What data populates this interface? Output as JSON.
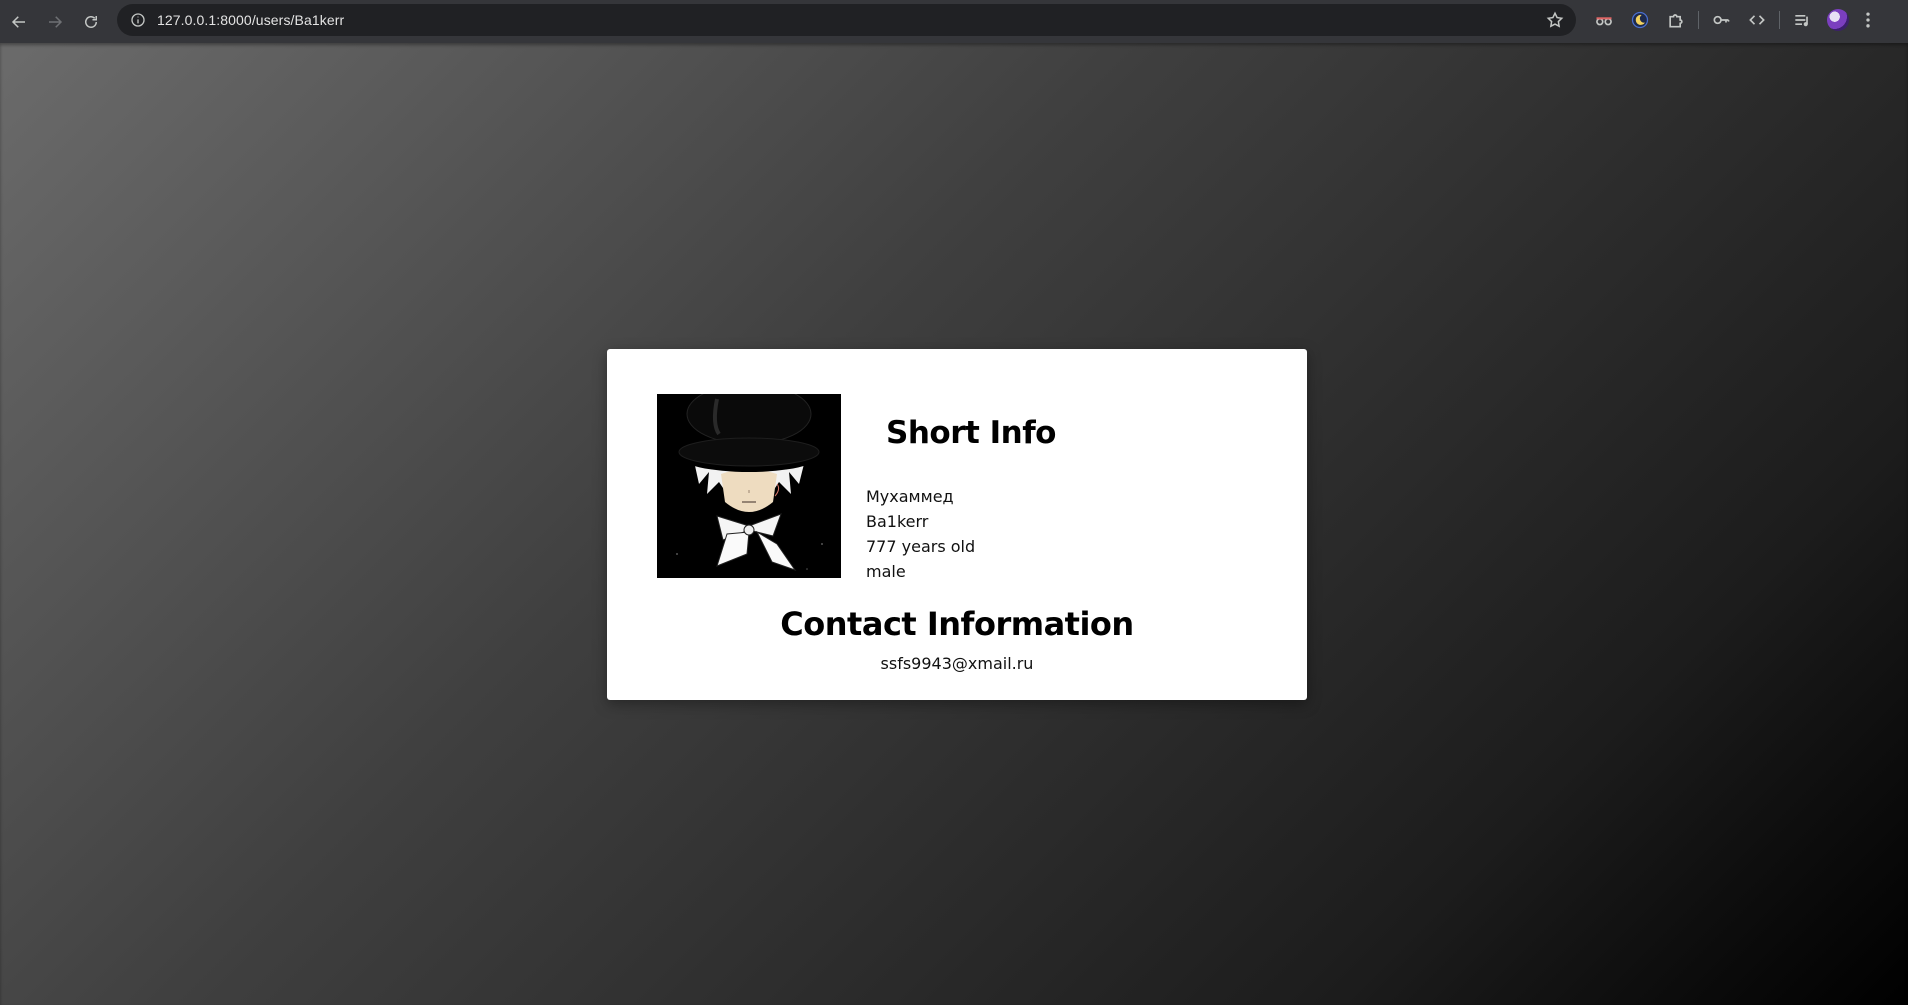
{
  "browser": {
    "url": "127.0.0.1:8000/users/Ba1kerr",
    "extensions": [
      "incognito-glasses-icon",
      "dark-mode-moon-icon",
      "puzzle-extensions-icon",
      "password-key-icon",
      "code-brackets-icon",
      "media-queue-icon"
    ]
  },
  "profile": {
    "short_info_title": "Short Info",
    "first_name": "Мухаммед",
    "username": "Ba1kerr",
    "age": "777 years old",
    "gender": "male"
  },
  "contact": {
    "title": "Contact Information",
    "email": "ssfs9943@xmail.ru"
  },
  "colors": {
    "card_bg": "#ffffff",
    "page_gradient_start": "#6b6b6b",
    "page_gradient_end": "#000000"
  }
}
